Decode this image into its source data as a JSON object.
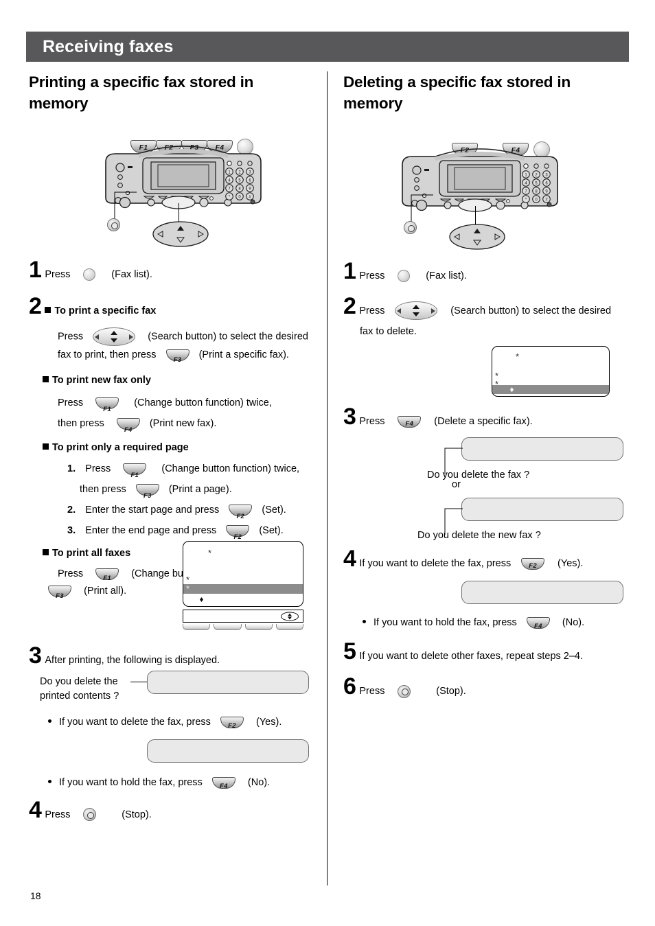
{
  "header": {
    "title": "Receiving faxes"
  },
  "page_number": "18",
  "left": {
    "section_title": "Printing a specific fax stored in memory",
    "diagram": {
      "fkey_labels": [
        "F1",
        "F2",
        "F3",
        "F4"
      ],
      "lamp_icon": "fax-list-lamp-icon",
      "stop_icon": "stop-button-icon",
      "search_icon": "search-button-icon",
      "keypad_keys": [
        "1",
        "2",
        "3",
        "4",
        "5",
        "6",
        "7",
        "8",
        "9",
        "*",
        "0",
        "#"
      ]
    },
    "steps": [
      {
        "num": "1",
        "text_before": "Press",
        "button": "fax-list-lamp",
        "text_after": "(Fax list)."
      },
      {
        "num": "2",
        "heading": "To print a specific fax"
      }
    ],
    "step2": {
      "heading": "To print a specific fax",
      "line1_a": "Press",
      "line1_b": "(Search button) to select the desired",
      "line2_a": "fax to print, then press",
      "line2_key": "F3",
      "line2_b": "(Print a specific fax)."
    },
    "block_new_fax": {
      "heading": "To print new fax only",
      "line1_a": "Press",
      "line1_key": "F1",
      "line1_b": "(Change button function) twice,",
      "line2_a": "then press",
      "line2_key": "F4",
      "line2_b": "(Print new fax)."
    },
    "block_required_page": {
      "heading": "To print only a required page",
      "items": [
        {
          "n": "1.",
          "a": "Press",
          "key": "F1",
          "b": "(Change button function) twice,",
          "a2": "then press",
          "key2": "F3",
          "b2": "(Print a page)."
        },
        {
          "n": "2.",
          "a": "Enter the start page and press",
          "key": "F2",
          "b": "(Set)."
        },
        {
          "n": "3.",
          "a": "Enter the end page and press",
          "key": "F2",
          "b": "(Set)."
        }
      ]
    },
    "block_all_faxes": {
      "heading": "To print all faxes",
      "line1_a": "Press",
      "line1_key": "F1",
      "line1_b": "(Change button function), then press",
      "line2_key": "F3",
      "line2_b": "(Print all)."
    },
    "step3": {
      "num": "3",
      "text": "After printing, the following is displayed.",
      "callout_line1": "Do you delete the",
      "callout_line2": "printed contents ?",
      "bullet1_a": "If you want to delete the fax, press",
      "bullet1_key": "F2",
      "bullet1_b": "(Yes).",
      "bullet2_a": "If you want to hold the fax, press",
      "bullet2_key": "F4",
      "bullet2_b": "(No)."
    },
    "step4": {
      "num": "4",
      "text_before": "Press",
      "text_after": "(Stop)."
    }
  },
  "right": {
    "section_title": "Deleting a specific fax stored in memory",
    "diagram": {
      "fkey_labels": [
        "F2",
        "F4"
      ],
      "lamp_icon": "fax-list-lamp-icon",
      "stop_icon": "stop-button-icon",
      "search_icon": "search-button-icon",
      "keypad_keys": [
        "1",
        "2",
        "3",
        "4",
        "5",
        "6",
        "7",
        "8",
        "9",
        "*",
        "0",
        "#"
      ]
    },
    "step1": {
      "num": "1",
      "text_before": "Press",
      "text_after": "(Fax list)."
    },
    "step2": {
      "num": "2",
      "line1_a": "Press",
      "line1_b": "(Search button) to select the desired",
      "line2": "fax to delete."
    },
    "step3": {
      "num": "3",
      "text_before": "Press",
      "key": "F4",
      "text_after": "(Delete a specific fax).",
      "caption1": "Do you delete the fax ?",
      "or": "or",
      "caption2": "Do you delete the new fax ?"
    },
    "step4": {
      "num": "4",
      "text_a": "If you want to delete the fax, press",
      "key": "F2",
      "text_b": "(Yes).",
      "bullet_a": "If you want to hold the fax, press",
      "bullet_key": "F4",
      "bullet_b": "(No)."
    },
    "step5": {
      "num": "5",
      "text": "If you want to delete other faxes, repeat steps 2–4."
    },
    "step6": {
      "num": "6",
      "text_before": "Press",
      "text_after": "(Stop)."
    }
  },
  "colors": {
    "header_bg": "#58585a",
    "lcd_highlight": "#8c8c8c",
    "balloon_bg": "#e9e9e9"
  }
}
